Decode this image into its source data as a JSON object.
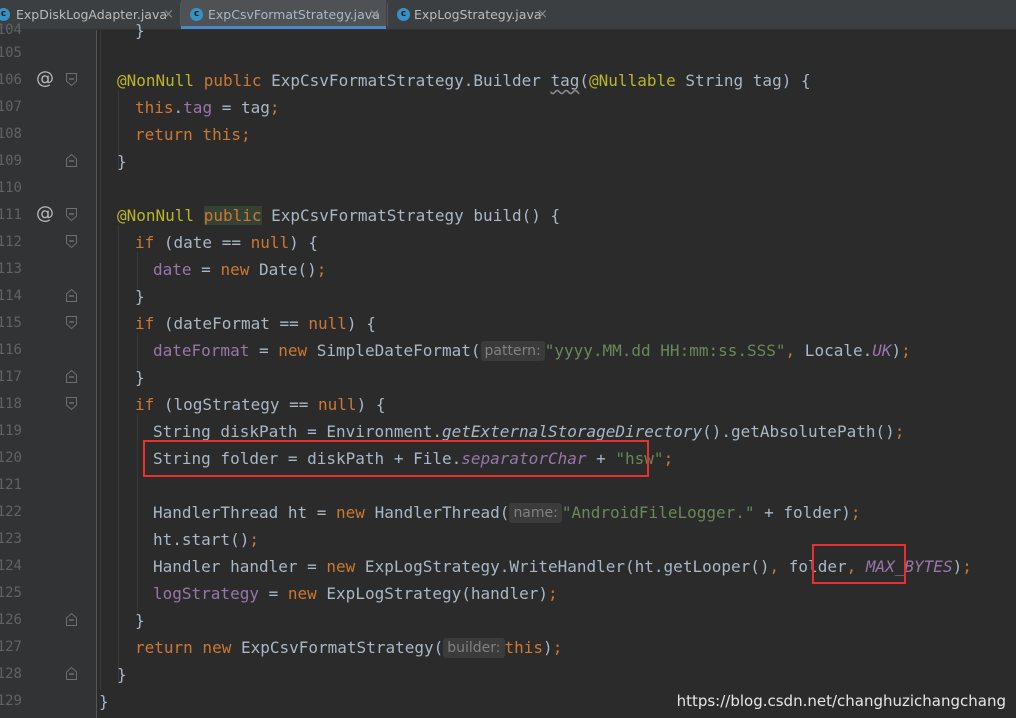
{
  "tabs": [
    {
      "label": "ExpDiskLogAdapter.java",
      "icon": "class-c-icon",
      "active": false
    },
    {
      "label": "ExpCsvFormatStrategy.java",
      "icon": "class-c-icon",
      "active": true
    },
    {
      "label": "ExpLogStrategy.java",
      "icon": "class-c-icon",
      "active": false
    }
  ],
  "tab_close_glyph": "×",
  "class_icon_letter": "c",
  "line_numbers": [
    "104",
    "105",
    "106",
    "107",
    "108",
    "109",
    "110",
    "111",
    "112",
    "113",
    "114",
    "115",
    "116",
    "117",
    "118",
    "119",
    "120",
    "121",
    "122",
    "123",
    "124",
    "125",
    "126",
    "127",
    "128",
    "129"
  ],
  "gutter_icons": {
    "override_glyph": "@"
  },
  "code": {
    "l104": "}",
    "l106": {
      "ann": "@NonNull",
      "kw_public": "public",
      "type": " ExpCsvFormatStrategy.Builder ",
      "method": "tag",
      "paren": "(",
      "ann2": "@Nullable",
      "rest": " String tag) {"
    },
    "l107": {
      "kw": "this",
      "dot": ".",
      "field": "tag",
      "rest": " = tag",
      "semi": ";"
    },
    "l108": {
      "kw": "return this",
      "semi": ";"
    },
    "l109": "}",
    "l111": {
      "ann": "@NonNull",
      "kw_public": "public",
      "rest": " ExpCsvFormatStrategy build() {"
    },
    "l112": {
      "kw_if": "if",
      "a": " (date == ",
      "kw_null": "null",
      "b": ") {"
    },
    "l113": {
      "field": "date",
      "a": " = ",
      "kw_new": "new",
      "b": " Date()",
      "semi": ";"
    },
    "l114": "}",
    "l115": {
      "kw_if": "if",
      "a": " (dateFormat == ",
      "kw_null": "null",
      "b": ") {"
    },
    "l116": {
      "field": "dateFormat",
      "a": " = ",
      "kw_new": "new",
      "b": " SimpleDateFormat(",
      "hint": "pattern:",
      "str": "\"yyyy.MM.dd HH:mm:ss.SSS\"",
      "comma": ",",
      "c": " Locale.",
      "sfield": "UK",
      "d": ")",
      "semi": ";"
    },
    "l117": "}",
    "l118": {
      "kw_if": "if",
      "a": " (logStrategy == ",
      "kw_null": "null",
      "b": ") {"
    },
    "l119": {
      "a": "String diskPath = Environment.",
      "m": "getExternalStorageDirectory",
      "b": "().getAbsolutePath()",
      "semi": ";"
    },
    "l120": {
      "a": "String folder = diskPath + File.",
      "sfield": "separatorChar",
      "b": " + ",
      "str": "\"hsw\"",
      "semi": ";"
    },
    "l122": {
      "a": "HandlerThread ht = ",
      "kw_new": "new",
      "b": " HandlerThread(",
      "hint": "name:",
      "str": "\"AndroidFileLogger.\"",
      "c": " + folder)",
      "semi": ";"
    },
    "l123": {
      "a": "ht.start()",
      "semi": ";"
    },
    "l124": {
      "a": "Handler handler = ",
      "kw_new": "new",
      "b": " ExpLogStrategy.WriteHandler(ht.getLooper()",
      "comma1": ",",
      "c": " folder",
      "comma2": ",",
      "sfield": "MAX_BYTES",
      "d": ")",
      "semi": ";"
    },
    "l125": {
      "field": "logStrategy",
      "a": " = ",
      "kw_new": "new",
      "b": " ExpLogStrategy(handler)",
      "semi": ";"
    },
    "l126": "}",
    "l127": {
      "kw": "return new",
      "a": " ExpCsvFormatStrategy(",
      "hint": "builder:",
      "kw_this": "this",
      "b": ")",
      "semi": ";"
    },
    "l128": "}",
    "l129": "}"
  },
  "watermark": "https://blog.csdn.net/changhuzichangchang",
  "colors": {
    "background": "#2b2b2b",
    "keyword": "#cc7832",
    "annotation": "#bbb529",
    "field": "#9876aa",
    "string": "#6a8759",
    "highlight_box": "#e8312f"
  }
}
